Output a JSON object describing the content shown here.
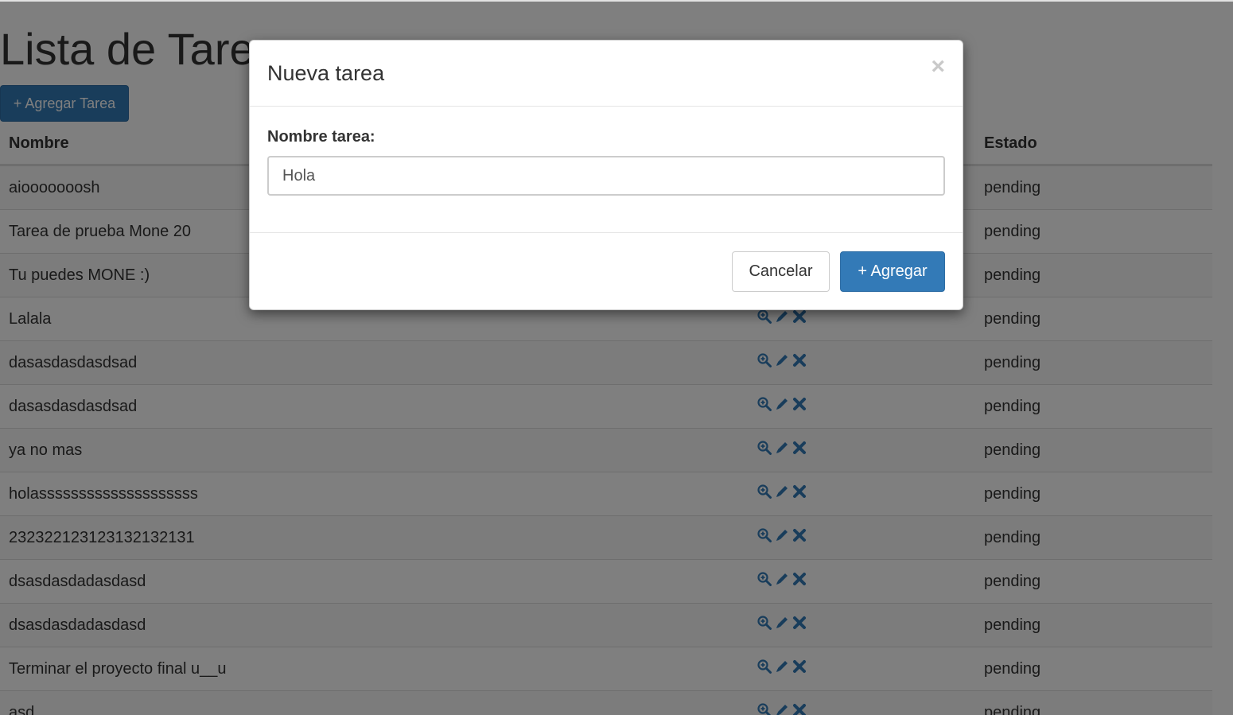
{
  "page": {
    "title": "Lista de Tareas",
    "add_button_label": "+ Agregar Tarea"
  },
  "table": {
    "headers": {
      "name": "Nombre",
      "actions": "",
      "status": "Estado"
    },
    "rows": [
      {
        "name": "aiooooooosh",
        "status": "pending"
      },
      {
        "name": "Tarea de prueba Mone 20",
        "status": "pending"
      },
      {
        "name": "Tu puedes MONE :)",
        "status": "pending"
      },
      {
        "name": "Lalala",
        "status": "pending"
      },
      {
        "name": "dasasdasdasdsad",
        "status": "pending"
      },
      {
        "name": "dasasdasdasdsad",
        "status": "pending"
      },
      {
        "name": "ya no mas",
        "status": "pending"
      },
      {
        "name": "holassssssssssssssssssss",
        "status": "pending"
      },
      {
        "name": "232322123123132132131",
        "status": "pending"
      },
      {
        "name": "dsasdasdadasdasd",
        "status": "pending"
      },
      {
        "name": "dsasdasdadasdasd",
        "status": "pending"
      },
      {
        "name": "Terminar el proyecto final u__u",
        "status": "pending"
      },
      {
        "name": "asd",
        "status": "pending"
      }
    ],
    "row_action_icons": [
      "zoom-in-icon",
      "pencil-icon",
      "remove-icon"
    ]
  },
  "modal": {
    "title": "Nueva tarea",
    "close_symbol": "×",
    "field_label": "Nombre tarea:",
    "field_value": "Hola",
    "cancel_label": "Cancelar",
    "submit_label": "+ Agregar"
  },
  "colors": {
    "primary": "#337ab7",
    "backdrop": "rgba(0,0,0,0.5)",
    "icon": "#337ab7"
  }
}
